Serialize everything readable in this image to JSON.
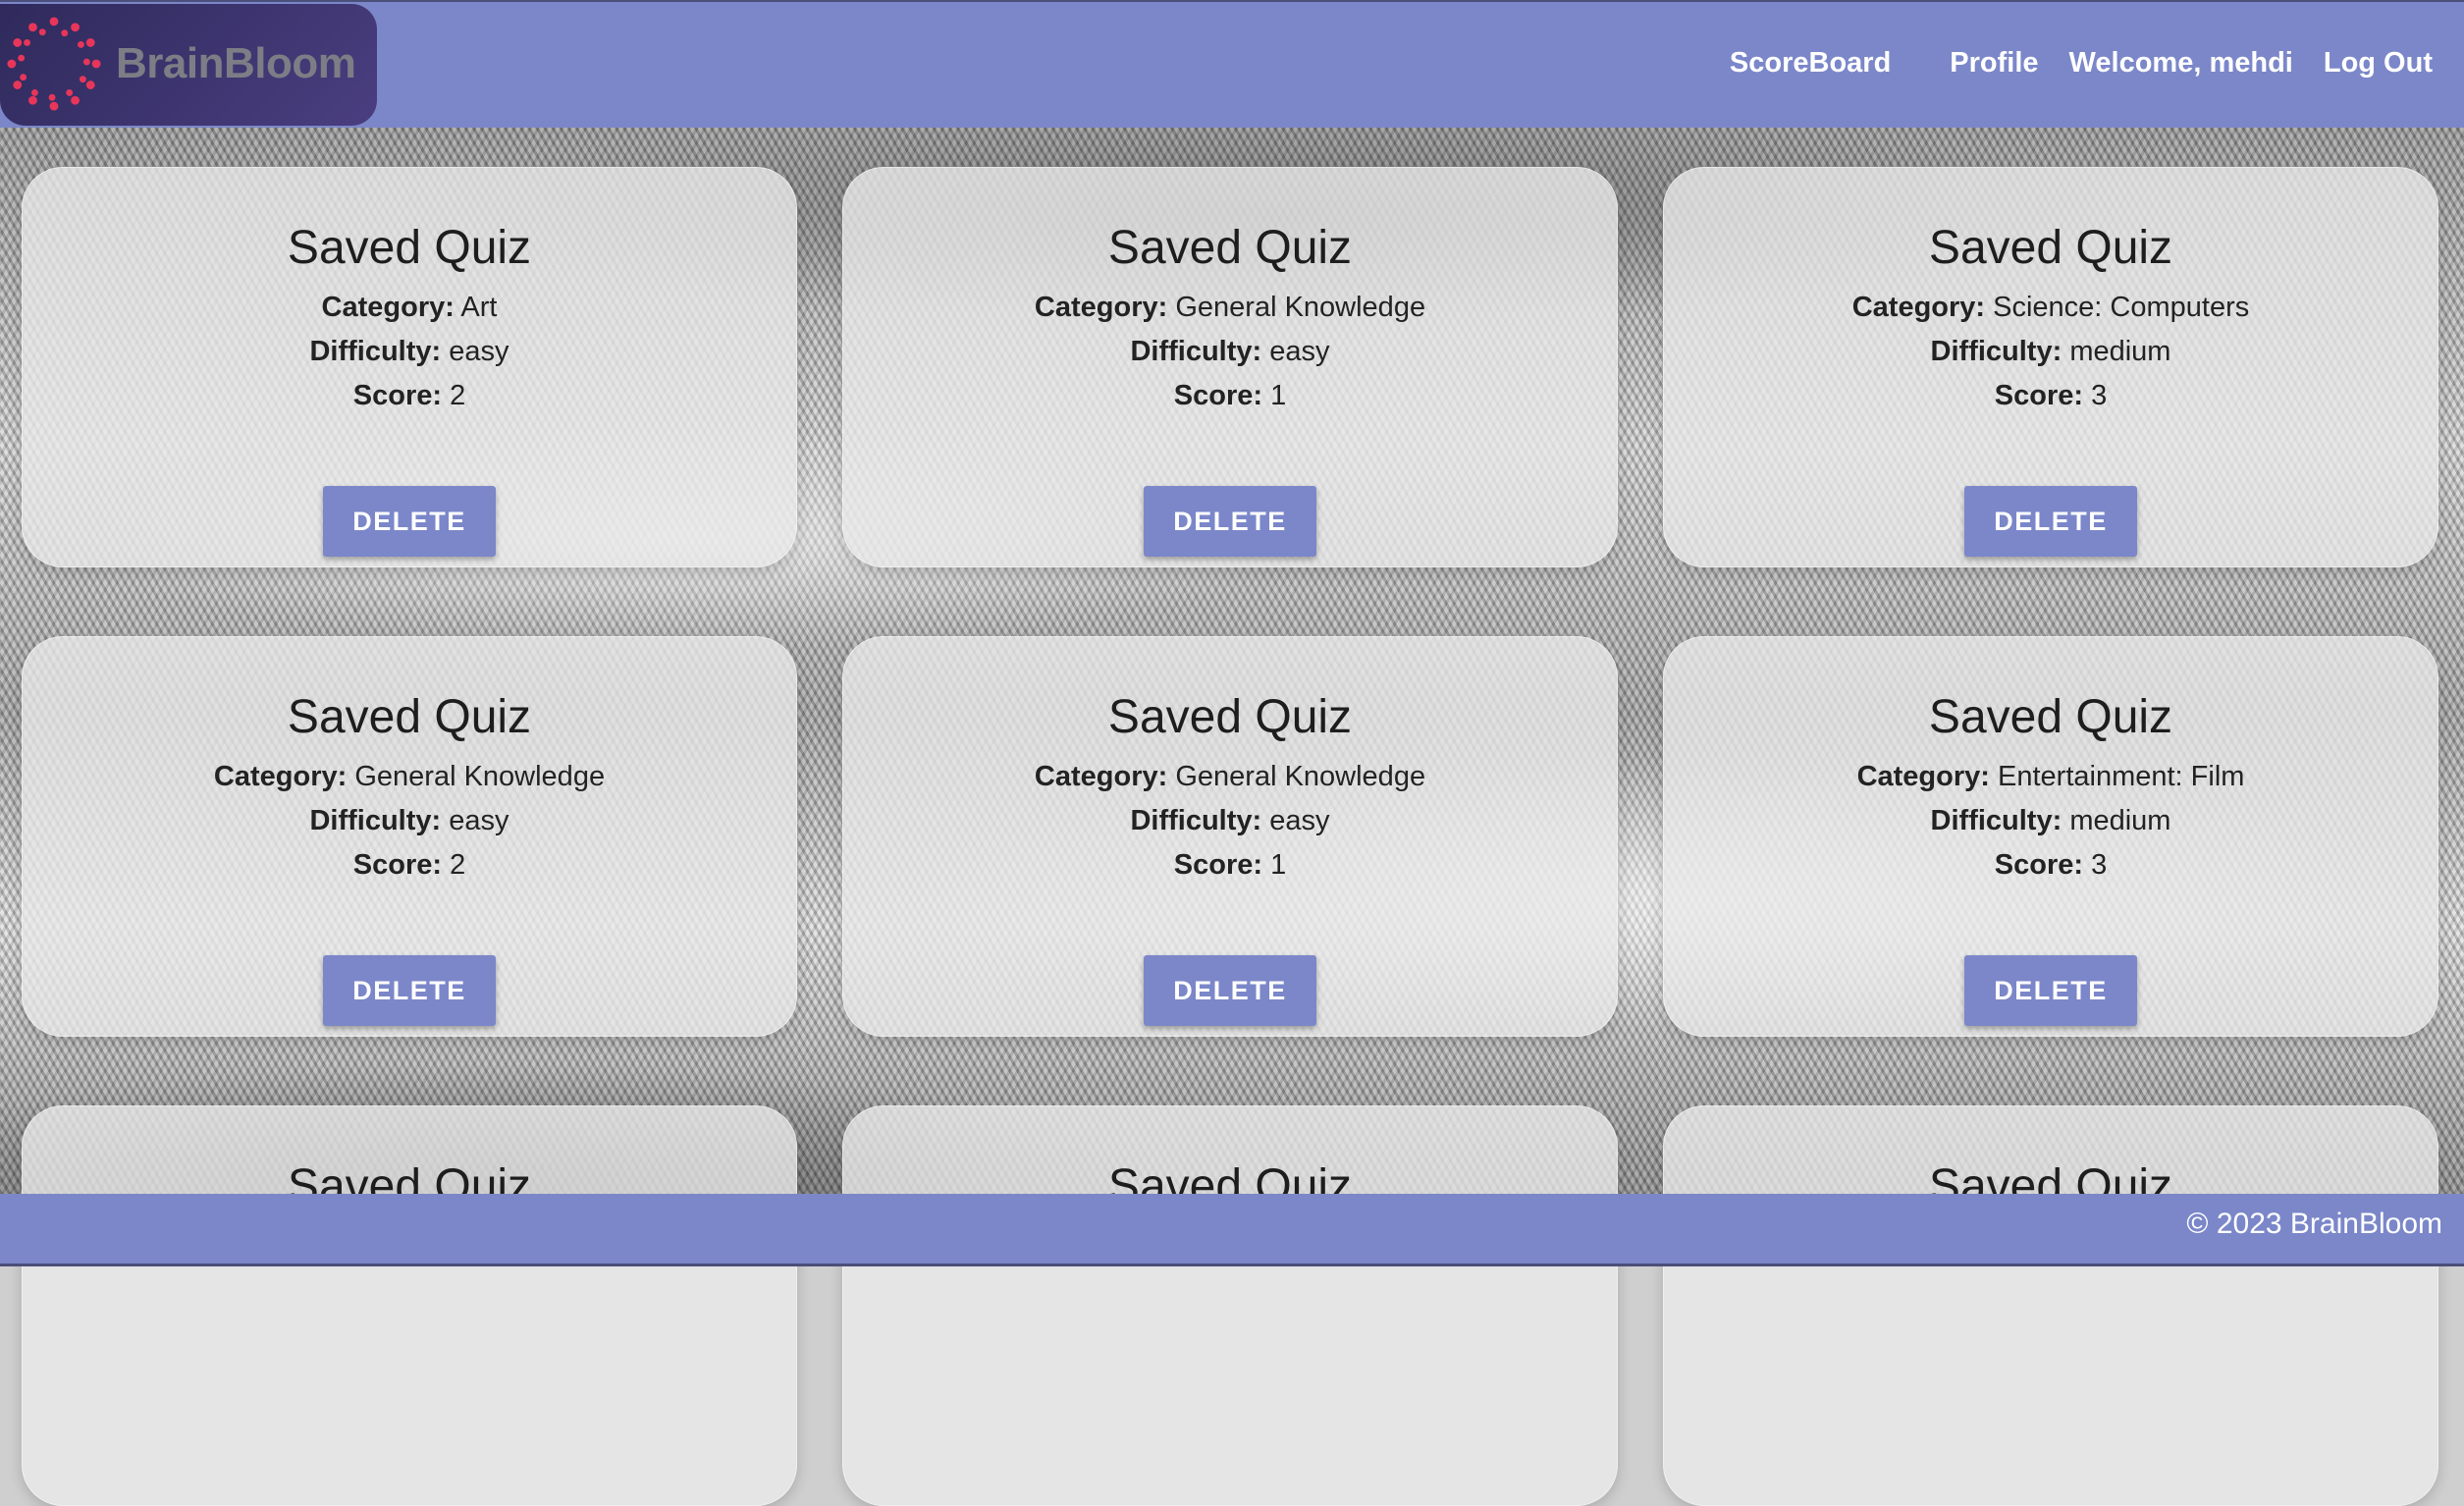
{
  "brand": {
    "name": "BrainBloom"
  },
  "nav": {
    "scoreboard": "ScoreBoard",
    "profile": "Profile",
    "welcome": "Welcome, mehdi",
    "logout": "Log Out"
  },
  "labels": {
    "category": "Category:",
    "difficulty": "Difficulty:",
    "score": "Score:"
  },
  "quizzes": [
    {
      "title": "Saved Quiz",
      "category": "Art",
      "difficulty": "easy",
      "score": "2",
      "delete_label": "DELETE"
    },
    {
      "title": "Saved Quiz",
      "category": "General Knowledge",
      "difficulty": "easy",
      "score": "1",
      "delete_label": "DELETE"
    },
    {
      "title": "Saved Quiz",
      "category": "Science: Computers",
      "difficulty": "medium",
      "score": "3",
      "delete_label": "DELETE"
    },
    {
      "title": "Saved Quiz",
      "category": "General Knowledge",
      "difficulty": "easy",
      "score": "2",
      "delete_label": "DELETE"
    },
    {
      "title": "Saved Quiz",
      "category": "General Knowledge",
      "difficulty": "easy",
      "score": "1",
      "delete_label": "DELETE"
    },
    {
      "title": "Saved Quiz",
      "category": "Entertainment: Film",
      "difficulty": "medium",
      "score": "3",
      "delete_label": "DELETE"
    },
    {
      "title": "Saved Quiz"
    },
    {
      "title": "Saved Quiz"
    },
    {
      "title": "Saved Quiz"
    }
  ],
  "footer": {
    "text": "© 2023 BrainBloom"
  },
  "colors": {
    "primary": "#7b87c9",
    "logo_bg": "#3a3370",
    "logo_dots": "#e8365a"
  }
}
